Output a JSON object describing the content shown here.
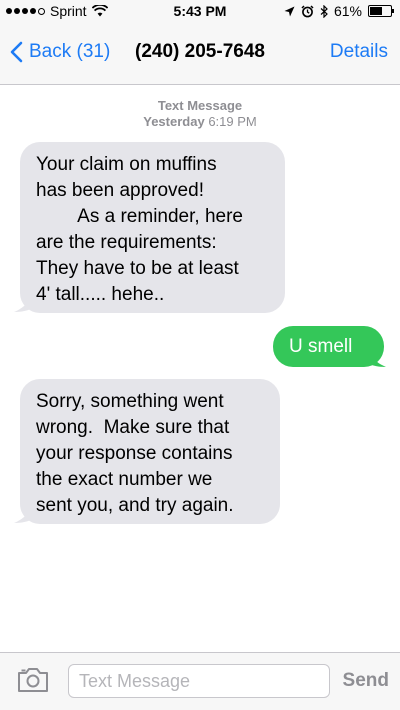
{
  "status_bar": {
    "carrier": "Sprint",
    "time": "5:43 PM",
    "battery_percent": "61%",
    "battery_level": 0.61
  },
  "nav": {
    "back_label": "Back (31)",
    "title": "(240) 205-7648",
    "details_label": "Details"
  },
  "thread_header": {
    "type": "Text Message",
    "day": "Yesterday",
    "time": "6:19 PM"
  },
  "messages": [
    {
      "direction": "incoming",
      "lines": [
        "Your claim on muffins",
        "has been approved!",
        "        As a reminder, here",
        "are the requirements:",
        "They have to be at least",
        "4' tall..... hehe.."
      ]
    },
    {
      "direction": "outgoing",
      "lines": [
        "U smell"
      ]
    },
    {
      "direction": "incoming",
      "lines": [
        "Sorry, something went",
        "wrong.  Make sure that",
        "your response contains",
        "the exact number we",
        "sent you, and try again."
      ]
    }
  ],
  "compose": {
    "placeholder": "Text Message",
    "send_label": "Send"
  },
  "colors": {
    "accent": "#1d7bf5",
    "incoming_bubble": "#e5e5ea",
    "outgoing_bubble": "#34c759"
  },
  "icons": [
    "wifi-icon",
    "location-arrow-icon",
    "alarm-icon",
    "bluetooth-icon",
    "battery-icon",
    "back-chevron-icon",
    "camera-icon"
  ]
}
